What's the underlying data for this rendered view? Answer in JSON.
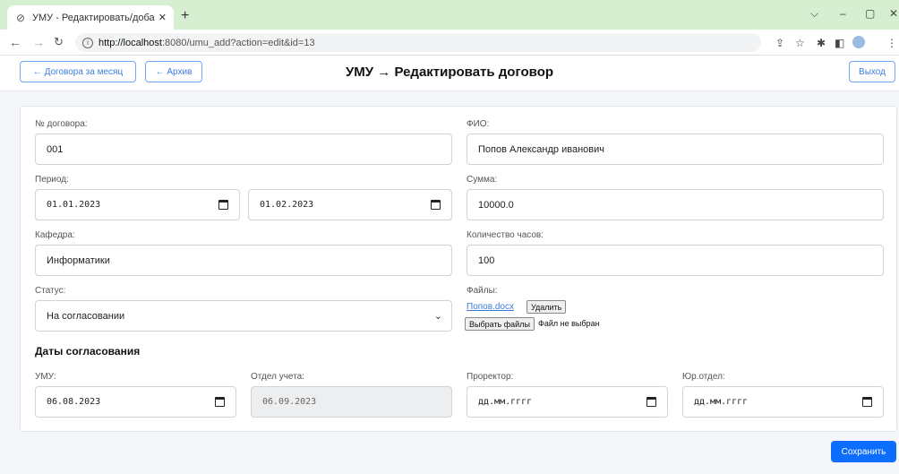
{
  "browser": {
    "tab_title": "УМУ - Редактировать/добавить",
    "tab_close": "✕",
    "new_tab": "+",
    "url_host": "http://localhost",
    "url_rest": ":8080/umu_add?action=edit&id=13",
    "window_controls": [
      "⌵",
      "–",
      "▢",
      "✕"
    ]
  },
  "header": {
    "back_month_label": "← Договора за месяц",
    "back_archive_label": "← Архив",
    "title": "УМУ → Редактировать договор",
    "exit_label": "Выход"
  },
  "form": {
    "contract_no": {
      "label": "№ договора:",
      "value": "001"
    },
    "fio": {
      "label": "ФИО:",
      "value": "Попов Александр иванович"
    },
    "period": {
      "label": "Период:",
      "from": "01.01.2023",
      "to": "01.02.2023"
    },
    "sum": {
      "label": "Сумма:",
      "value": "10000.0"
    },
    "department": {
      "label": "Кафедра:",
      "value": "Информатики"
    },
    "hours": {
      "label": "Количество часов:",
      "value": "100"
    },
    "status": {
      "label": "Статус:",
      "value": "На согласовании"
    },
    "files": {
      "label": "Файлы:",
      "file_name": "Попов.docx",
      "delete_label": "Удалить",
      "choose_label": "Выбрать файлы",
      "no_file_text": "Файл не выбран"
    },
    "approval": {
      "heading": "Даты согласования",
      "umu": {
        "label": "УМУ:",
        "value": "06.08.2023"
      },
      "accounting": {
        "label": "Отдел учета:",
        "value": "06.09.2023"
      },
      "prorector": {
        "label": "Проректор:",
        "value": "дд.мм.гггг"
      },
      "legal": {
        "label": "Юр.отдел:",
        "value": "дд.мм.гггг"
      }
    }
  },
  "save_label": "Сохранить"
}
